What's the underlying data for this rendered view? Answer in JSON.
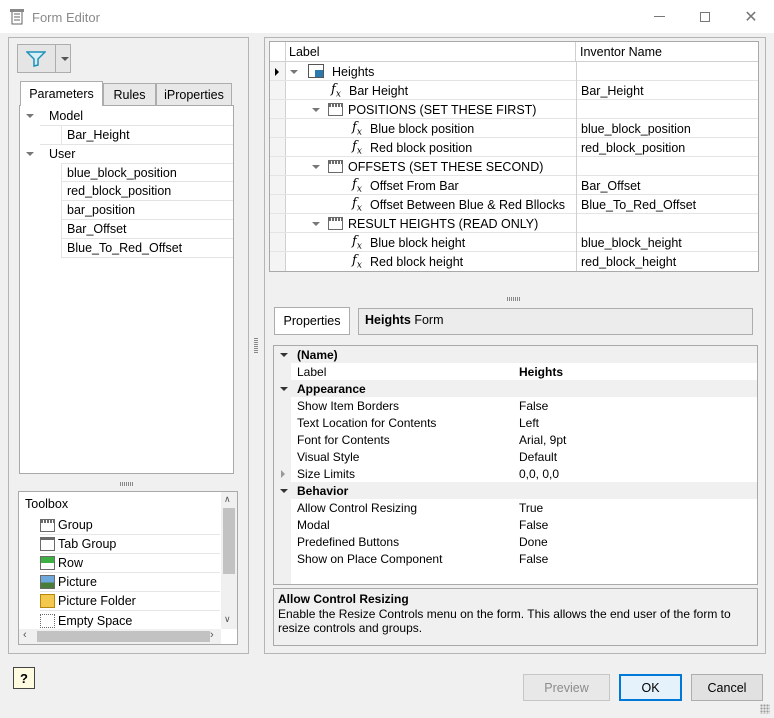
{
  "window": {
    "title": "Form Editor"
  },
  "left": {
    "tabs": [
      {
        "label": "Parameters",
        "active": true
      },
      {
        "label": "Rules",
        "active": false
      },
      {
        "label": "iProperties",
        "active": false
      }
    ],
    "tree": {
      "model": {
        "label": "Model",
        "children": [
          "Bar_Height"
        ]
      },
      "user": {
        "label": "User",
        "children": [
          "blue_block_position",
          "red_block_position",
          "bar_position",
          "Bar_Offset",
          "Blue_To_Red_Offset"
        ]
      }
    },
    "toolbox": {
      "title": "Toolbox",
      "items": [
        "Group",
        "Tab Group",
        "Row",
        "Picture",
        "Picture Folder",
        "Empty Space"
      ]
    }
  },
  "grid": {
    "headers": {
      "label": "Label",
      "name": "Inventor Name"
    },
    "root": {
      "label": "Heights"
    },
    "rows": [
      {
        "type": "param",
        "indent": 1,
        "label": "Bar Height",
        "name": "Bar_Height"
      },
      {
        "type": "group",
        "indent": 1,
        "label": "POSITIONS (SET THESE FIRST)",
        "name": ""
      },
      {
        "type": "param",
        "indent": 2,
        "label": "Blue block position",
        "name": "blue_block_position"
      },
      {
        "type": "param",
        "indent": 2,
        "label": "Red block position",
        "name": "red_block_position"
      },
      {
        "type": "group",
        "indent": 1,
        "label": "OFFSETS (SET THESE SECOND)",
        "name": ""
      },
      {
        "type": "param",
        "indent": 2,
        "label": "Offset From Bar",
        "name": "Bar_Offset"
      },
      {
        "type": "param",
        "indent": 2,
        "label": "Offset Between Blue & Red Bllocks",
        "name": "Blue_To_Red_Offset"
      },
      {
        "type": "group",
        "indent": 1,
        "label": "RESULT HEIGHTS (READ ONLY)",
        "name": ""
      },
      {
        "type": "param",
        "indent": 2,
        "label": "Blue block height",
        "name": "blue_block_height"
      },
      {
        "type": "param",
        "indent": 2,
        "label": "Red block height",
        "name": "red_block_height"
      }
    ]
  },
  "properties": {
    "tab_label": "Properties",
    "header_bold": "Heights",
    "header_rest": " Form",
    "rows": [
      {
        "cat": true,
        "label": "(Name)"
      },
      {
        "label": "Label",
        "value": "Heights",
        "bold": true
      },
      {
        "cat": true,
        "label": "Appearance"
      },
      {
        "label": "Show Item Borders",
        "value": "False"
      },
      {
        "label": "Text Location for Contents",
        "value": "Left"
      },
      {
        "label": "Font for Contents",
        "value": "Arial, 9pt"
      },
      {
        "label": "Visual Style",
        "value": "Default"
      },
      {
        "label": "Size Limits",
        "value": "0,0, 0,0",
        "collapsed": true
      },
      {
        "cat": true,
        "label": "Behavior"
      },
      {
        "label": "Allow Control Resizing",
        "value": "True"
      },
      {
        "label": "Modal",
        "value": "False"
      },
      {
        "label": "Predefined Buttons",
        "value": "Done"
      },
      {
        "label": "Show on Place Component",
        "value": "False"
      }
    ],
    "description": {
      "title": "Allow Control Resizing",
      "text": "Enable the Resize Controls menu on the form.  This allows the end user of the form to resize controls and groups."
    }
  },
  "buttons": {
    "preview": "Preview",
    "ok": "OK",
    "cancel": "Cancel",
    "help": "?"
  },
  "colors": {
    "accent": "#0078d7",
    "filter": "#1e8fb8"
  }
}
